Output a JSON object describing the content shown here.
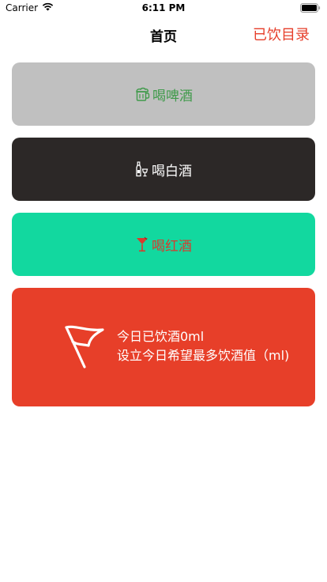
{
  "status_bar": {
    "carrier": "Carrier",
    "time": "6:11 PM",
    "wifi_icon": "wifi-icon",
    "battery_icon": "battery-icon"
  },
  "nav": {
    "title": "首页",
    "right_button": "已饮目录"
  },
  "cards": {
    "beer": {
      "label": "喝啤酒",
      "icon": "beer-mug-icon",
      "color": "#3f9a4a",
      "background": "#c0c0c0"
    },
    "baijiu": {
      "label": "喝白酒",
      "icon": "liquor-bottle-icon",
      "color": "#ffffff",
      "background": "#2c2827"
    },
    "wine": {
      "label": "喝红酒",
      "icon": "cocktail-glass-icon",
      "color": "#d83a2d",
      "background": "#12d89f"
    }
  },
  "today": {
    "consumed_text": "今日已饮酒0ml",
    "goal_prompt": "设立今日希望最多饮酒值（ml)",
    "icon": "flag-icon",
    "background": "#e73f29"
  }
}
